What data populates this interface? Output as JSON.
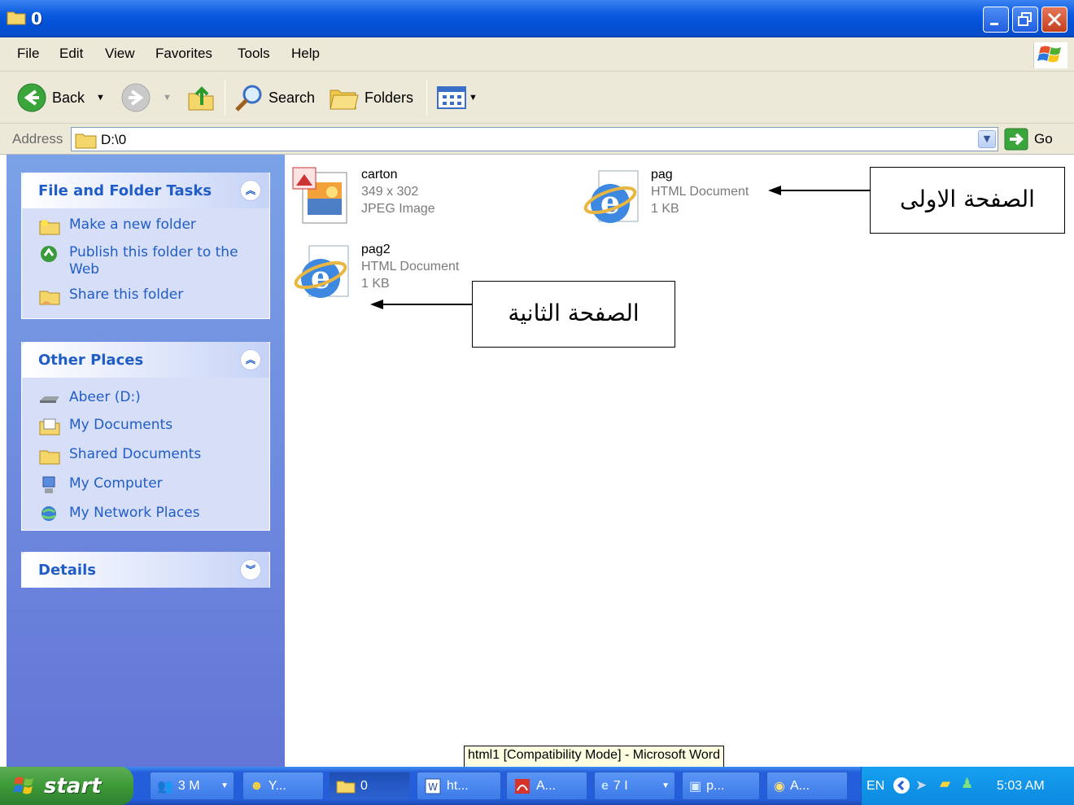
{
  "window": {
    "title": "0"
  },
  "menu": {
    "items": [
      "File",
      "Edit",
      "View",
      "Favorites",
      "Tools",
      "Help"
    ]
  },
  "toolbar": {
    "back_label": "Back",
    "search_label": "Search",
    "folders_label": "Folders"
  },
  "address": {
    "label": "Address",
    "value": "D:\\0",
    "go_label": "Go"
  },
  "sidebar": {
    "file_tasks": {
      "title": "File and Folder Tasks",
      "items": [
        {
          "label": "Make a new folder",
          "icon": "new-folder-icon"
        },
        {
          "label": "Publish this folder to the Web",
          "icon": "publish-web-icon"
        },
        {
          "label": "Share this folder",
          "icon": "share-folder-icon"
        }
      ]
    },
    "other_places": {
      "title": "Other Places",
      "items": [
        {
          "label": "Abeer (D:)",
          "icon": "drive-icon"
        },
        {
          "label": "My Documents",
          "icon": "my-documents-icon"
        },
        {
          "label": "Shared Documents",
          "icon": "shared-documents-icon"
        },
        {
          "label": "My Computer",
          "icon": "my-computer-icon"
        },
        {
          "label": "My Network Places",
          "icon": "network-places-icon"
        }
      ]
    },
    "details": {
      "title": "Details"
    }
  },
  "files": [
    {
      "name": "carton",
      "line2": "349 x 302",
      "line3": "JPEG Image",
      "icon": "jpeg-image-icon"
    },
    {
      "name": "pag",
      "line2": "HTML Document",
      "line3": "1 KB",
      "icon": "ie-html-icon"
    },
    {
      "name": "pag2",
      "line2": "HTML Document",
      "line3": "1 KB",
      "icon": "ie-html-icon"
    }
  ],
  "callouts": {
    "first_page": "الصفحة الاولى",
    "second_page": "الصفحة الثانية"
  },
  "tooltip": "html1 [Compatibility Mode] - Microsoft Word",
  "taskbar": {
    "start_label": "start",
    "buttons": [
      "3 M",
      "Y...",
      "0",
      "ht...",
      "A...",
      "7 I",
      "p...",
      "A..."
    ],
    "lang": "EN",
    "clock": "5:03 AM"
  },
  "colors": {
    "titlebar": "#0a5ae0",
    "sidebar": "#6375d6",
    "link": "#215dc6",
    "start": "#3c9a37"
  }
}
